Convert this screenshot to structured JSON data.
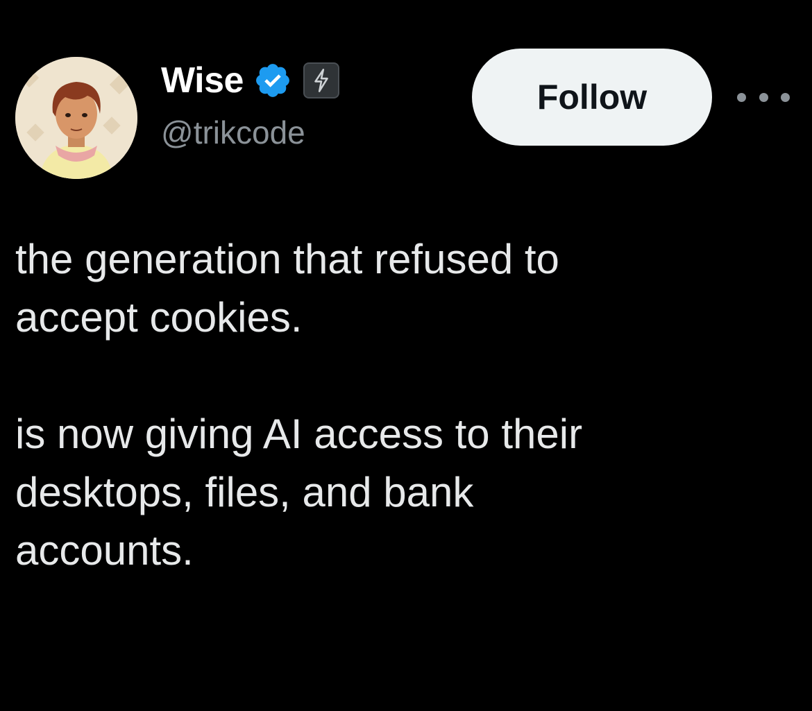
{
  "author": {
    "display_name": "Wise",
    "handle": "@trikcode",
    "verified": true,
    "badge_icon": "lightning-bolt-icon",
    "avatar_icon": "illustrated-avatar"
  },
  "actions": {
    "follow_label": "Follow",
    "more_icon": "more-options-icon"
  },
  "tweet": {
    "paragraphs": [
      "the generation that refused to\naccept cookies.",
      "is now giving  AI access to their\ndesktops, files, and bank\naccounts."
    ]
  },
  "colors": {
    "background": "#000000",
    "text": "#e7e9ea",
    "secondary_text": "#8b9298",
    "verified_blue": "#1d9bf0",
    "follow_bg": "#eff3f4"
  }
}
